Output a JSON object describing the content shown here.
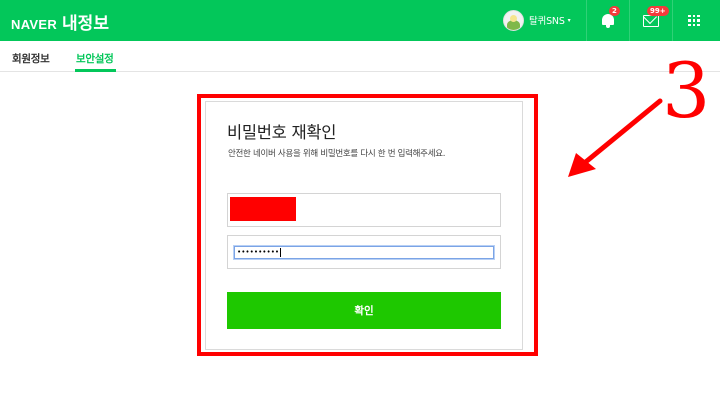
{
  "header": {
    "brand_logo": "NAVER",
    "brand_title": "내정보",
    "profile_name": "탈퀴SNS",
    "profile_caret": "▾",
    "notifications_badge": "2",
    "mail_badge": "99+"
  },
  "subnav": {
    "tabs": [
      {
        "label": "회원정보",
        "active": false
      },
      {
        "label": "보안설정",
        "active": true
      }
    ]
  },
  "card": {
    "title": "비밀번호 재확인",
    "description": "안전한 네이버 사용을 위해 비밀번호를 다시 한 번 입력해주세요.",
    "password_value": "••••••••••",
    "confirm_label": "확인"
  },
  "annotation": {
    "number": "3"
  },
  "colors": {
    "brand_green": "#03c75a",
    "button_green": "#1ec800",
    "annotation_red": "#ff0000",
    "badge_red": "#f43b3b"
  },
  "icons": [
    "bell-icon",
    "mail-icon",
    "apps-grid-icon",
    "caret-down-icon",
    "avatar"
  ]
}
